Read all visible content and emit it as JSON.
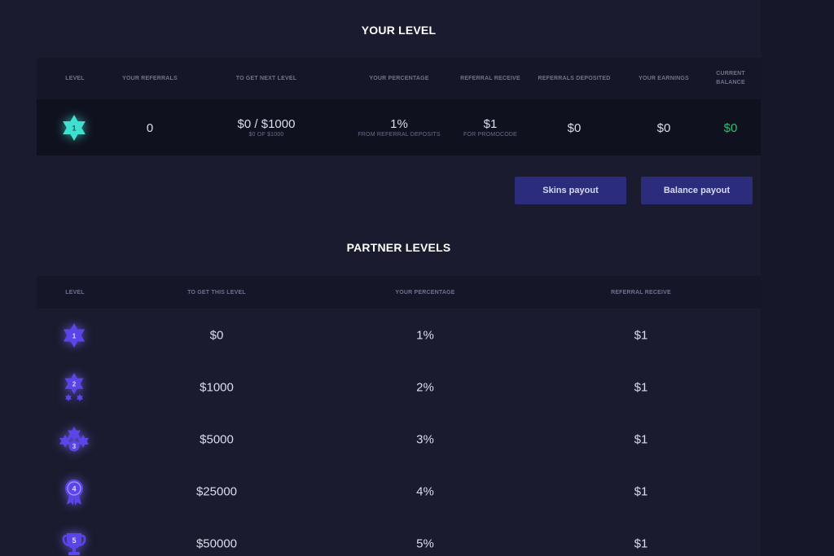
{
  "your_level": {
    "title": "YOUR LEVEL",
    "headers": {
      "level": "LEVEL",
      "referrals": "YOUR REFERRALS",
      "next_level": "TO GET NEXT LEVEL",
      "percentage": "YOUR PERCENTAGE",
      "referral_receive": "REFERRAL RECEIVE",
      "referrals_deposited": "REFERRALS DEPOSITED",
      "earnings": "YOUR EARNINGS",
      "balance_line1": "CURRENT",
      "balance_line2": "BALANCE"
    },
    "row": {
      "level": "1",
      "referrals": "0",
      "next_level": "$0 / $1000",
      "next_level_sub": "$0 OF $1000",
      "percentage": "1%",
      "percentage_sub": "FROM REFERRAL DEPOSITS",
      "referral_receive": "$1",
      "referral_receive_sub": "FOR PROMOCODE",
      "referrals_deposited": "$0",
      "earnings": "$0",
      "balance": "$0"
    },
    "level_icon_color": "#3fe0cf"
  },
  "buttons": {
    "skins_payout": "Skins payout",
    "balance_payout": "Balance payout"
  },
  "partner_levels": {
    "title": "PARTNER LEVELS",
    "headers": {
      "level": "LEVEL",
      "to_get": "TO GET THIS LEVEL",
      "percentage": "YOUR PERCENTAGE",
      "referral_receive": "REFERRAL RECEIVE"
    },
    "rows": [
      {
        "level": "1",
        "icon": "star-1-icon",
        "to_get": "$0",
        "percentage": "1%",
        "referral_receive": "$1"
      },
      {
        "level": "2",
        "icon": "star-2-icon",
        "to_get": "$1000",
        "percentage": "2%",
        "referral_receive": "$1"
      },
      {
        "level": "3",
        "icon": "star-3-icon",
        "to_get": "$5000",
        "percentage": "3%",
        "referral_receive": "$1"
      },
      {
        "level": "4",
        "icon": "medal-icon",
        "to_get": "$25000",
        "percentage": "4%",
        "referral_receive": "$1"
      },
      {
        "level": "5",
        "icon": "trophy-icon",
        "to_get": "$50000",
        "percentage": "5%",
        "referral_receive": "$1"
      }
    ],
    "icon_color": "#5a45e8"
  },
  "colors": {
    "background": "#1a1b2e",
    "header_bg": "#151627",
    "row_bg": "#10111f",
    "button_bg": "#2b2d7c",
    "balance_green": "#2fbf71"
  }
}
